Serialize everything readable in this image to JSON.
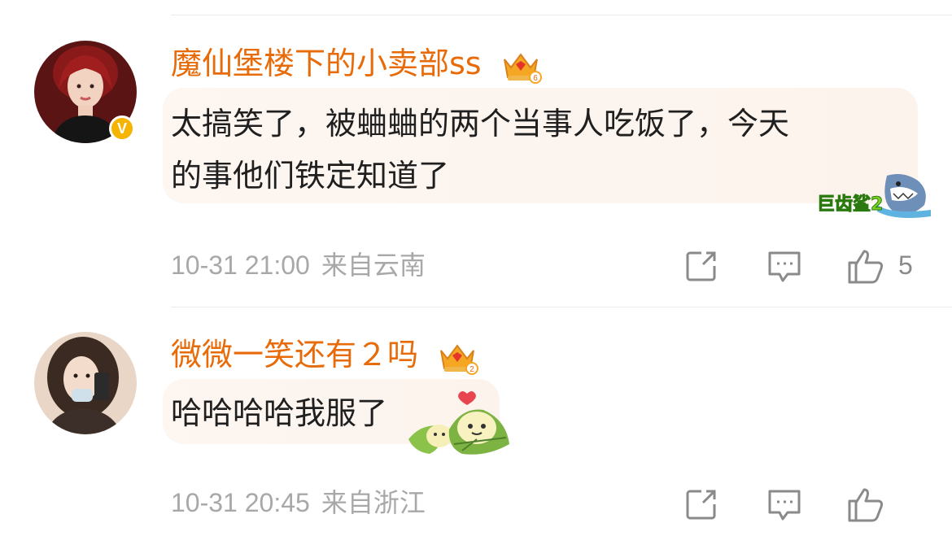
{
  "comments": [
    {
      "username": "魔仙堡楼下的小卖部ss",
      "text_line1": "太搞笑了，被蛐蛐的两个当事人吃饭了，今天",
      "text_line2": "的事他们铁定知道了",
      "timestamp": "10-31 21:00",
      "location": "来自云南",
      "likes": "5",
      "verified_badge": "V",
      "crown_level": "6",
      "sticker": "shark-sticker",
      "sticker_text": "巨齿鲨2"
    },
    {
      "username": "微微一笑还有２吗",
      "text_line1": "哈哈哈哈我服了",
      "timestamp": "10-31 20:45",
      "location": "来自浙江",
      "crown_level": "2",
      "sticker": "zongzi-sticker"
    }
  ],
  "icons": [
    "share-icon",
    "comment-icon",
    "like-icon",
    "crown-icon",
    "verified-icon"
  ],
  "colors": {
    "username": "#e86b0a",
    "meta": "#a8a8a8",
    "bubble": "#fdf6f1",
    "badge": "#f5b400"
  }
}
